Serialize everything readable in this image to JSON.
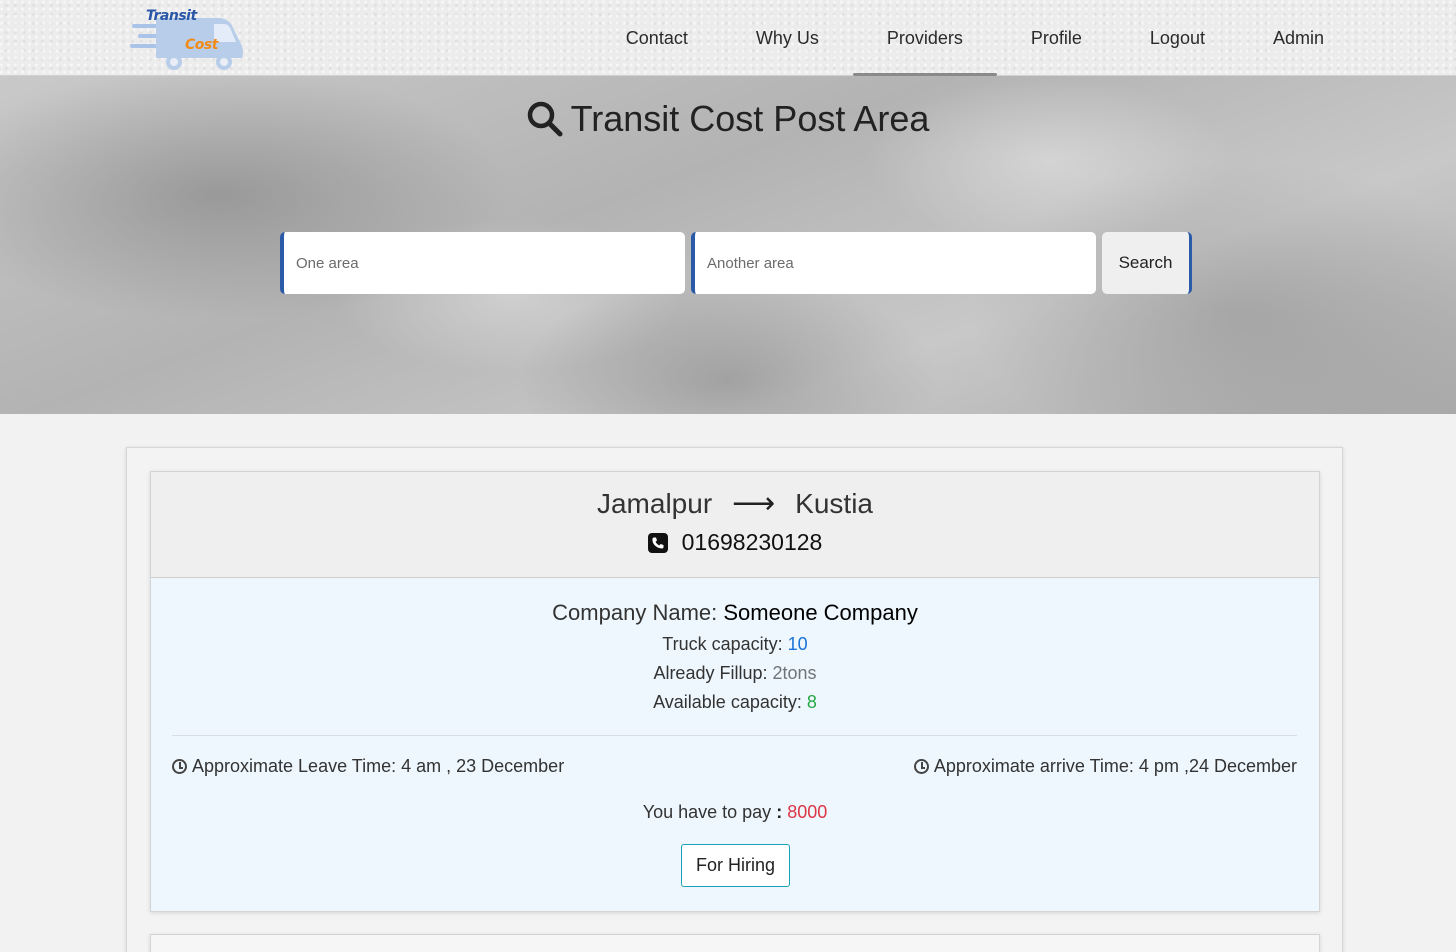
{
  "logo": {
    "line1": "Transit",
    "line2": "Cost"
  },
  "nav": {
    "items": [
      {
        "label": "Contact",
        "active": false
      },
      {
        "label": "Why Us",
        "active": false
      },
      {
        "label": "Providers",
        "active": true
      },
      {
        "label": "Profile",
        "active": false
      },
      {
        "label": "Logout",
        "active": false
      },
      {
        "label": "Admin",
        "active": false
      }
    ]
  },
  "hero": {
    "title": "Transit Cost Post Area",
    "icon": "search-icon"
  },
  "search": {
    "from_placeholder": "One area",
    "from_value": "",
    "to_placeholder": "Another area",
    "to_value": "",
    "button_label": "Search"
  },
  "posts": [
    {
      "from": "Jamalpur",
      "to": "Kustia",
      "phone": "01698230128",
      "company_label": "Company Name:",
      "company_name": "Someone Company",
      "truck_capacity_label": "Truck capacity:",
      "truck_capacity": "10",
      "fillup_label": "Already Fillup:",
      "fillup": "2tons",
      "available_label": "Available capacity:",
      "available": "8",
      "leave_label": "Approximate Leave Time:",
      "leave_time": "4 am , 23 December",
      "arrive_label": "Approximate arrive Time:",
      "arrive_time": "4 pm ,24 December",
      "pay_label": "You have to pay",
      "pay_colon": ":",
      "pay_amount": "8000",
      "action_label": "For Hiring"
    }
  ],
  "colors": {
    "accent_blue": "#2a5aa8",
    "capacity_blue": "#1a73d9",
    "available_green": "#28a745",
    "pay_red": "#dc3545",
    "hire_border": "#17a2b8",
    "card_body_bg": "#eef7fd"
  }
}
